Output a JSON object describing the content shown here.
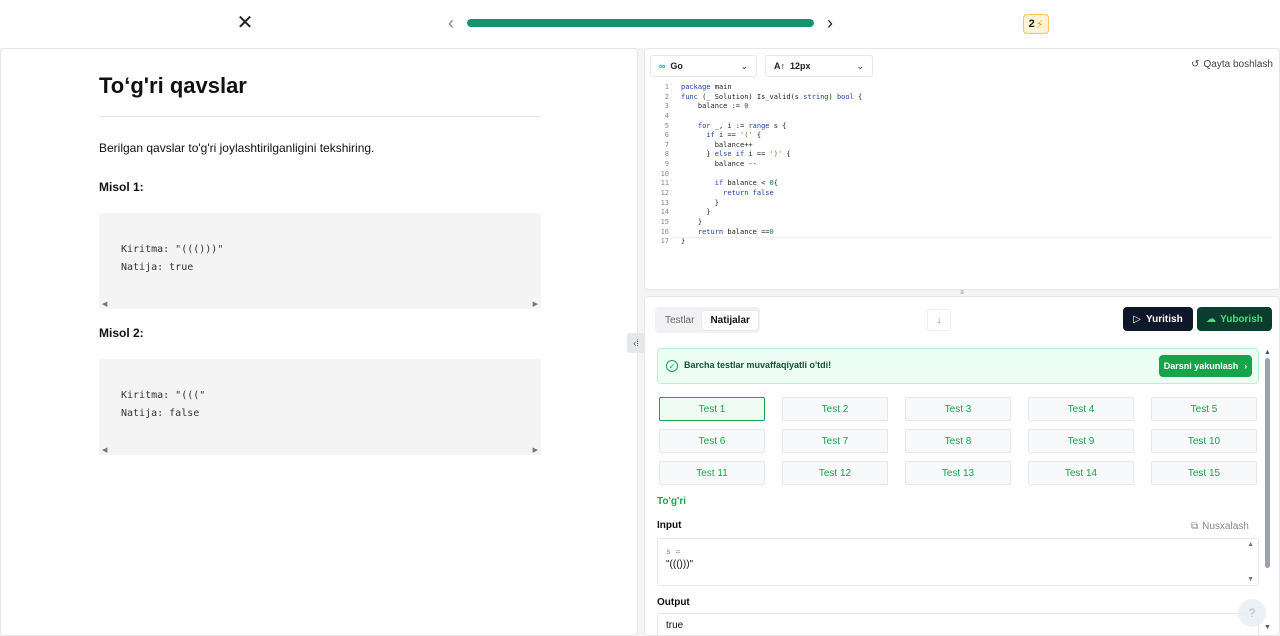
{
  "topbar": {
    "close_icon": "✕",
    "prev_icon": "‹",
    "next_icon": "›",
    "progress_fraction": 1.0,
    "streak_count": "2",
    "streak_icon": "⚡"
  },
  "problem": {
    "title": "To‘g'ri qavslar",
    "description": "Berilgan qavslar to'g'ri joylashtirilganligini tekshiring.",
    "examples": [
      {
        "label": "Misol 1:",
        "code": "Kiritma: \"((()))\"\nNatija: true"
      },
      {
        "label": "Misol 2:",
        "code": "Kiritma: \"(((\"\nNatija: false"
      }
    ]
  },
  "editor": {
    "language": "Go",
    "font_size": "12px",
    "reset_label": "Qayta boshlash",
    "line_numbers": [
      "1",
      "2",
      "3",
      "4",
      "5",
      "6",
      "7",
      "8",
      "9",
      "10",
      "11",
      "12",
      "13",
      "14",
      "15",
      "16",
      "17"
    ]
  },
  "results": {
    "tab_tests": "Testlar",
    "tab_results": "Natijalar",
    "run_label": "Yuritish",
    "submit_label": "Yuborish",
    "banner_message": "Barcha testlar muvaffaqiyatli o'tdi!",
    "finish_label": "Darsni yakunlash",
    "tests": [
      "Test 1",
      "Test 2",
      "Test 3",
      "Test 4",
      "Test 5",
      "Test 6",
      "Test 7",
      "Test 8",
      "Test 9",
      "Test 10",
      "Test 11",
      "Test 12",
      "Test 13",
      "Test 14",
      "Test 15"
    ],
    "selected_test": "Test 1",
    "verdict": "To'g'ri",
    "input_label": "Input",
    "copy_label": "Nusxalash",
    "input_var": "s =",
    "input_value": "\"((()))\"",
    "output_label": "Output",
    "output_value": "true"
  },
  "help_icon": "?",
  "colors": {
    "accent": "#16936e",
    "success": "#16a34a",
    "dark_button": "#0f172a"
  }
}
